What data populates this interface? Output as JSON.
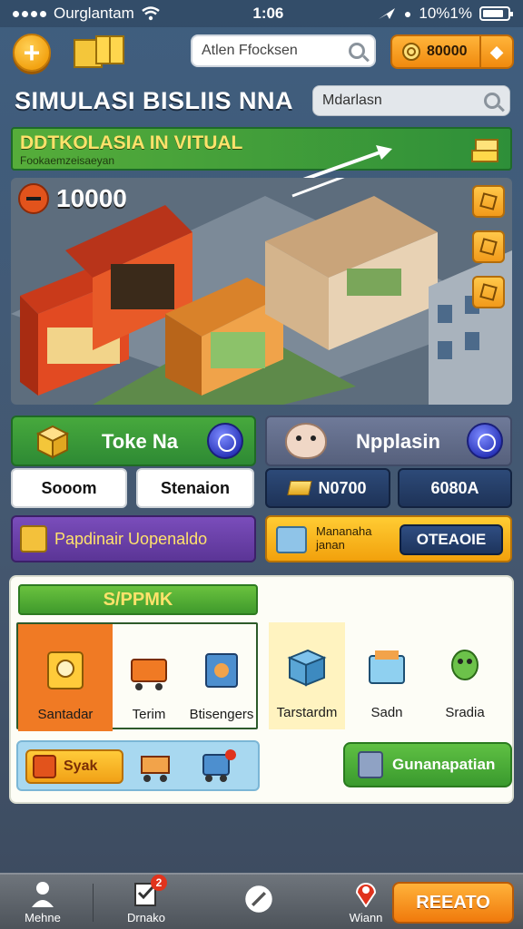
{
  "status_bar": {
    "carrier": "Ourglantam",
    "time": "1:06",
    "battery_percent": "10%1%"
  },
  "top_bar": {
    "search_placeholder": "Atlen Ffocksen",
    "coins": "80000"
  },
  "title_bar": {
    "title": "SIMULASI BISLIIS NNA",
    "search_text": "Mdarlasn"
  },
  "banner": {
    "headline": "DDTKOLASIA IN VITUAL",
    "subline": "Fookaemzeisaeyan"
  },
  "scene": {
    "score": "10000"
  },
  "cards": {
    "toko_label": "Toke Na",
    "toko_btn_1": "Sooom",
    "toko_btn_2": "Stenaion",
    "npplasin_label": "Npplasin",
    "npplasin_btn_1": "N0700",
    "npplasin_btn_2": "6080A",
    "purple_label": "Papdinair Uopenaldo",
    "orange_label": "Mananaha janan",
    "orange_pill": "OTEAOIE"
  },
  "shop": {
    "tab": "S/PPMK",
    "items": [
      {
        "label": "Santadar",
        "icon": "machine-icon"
      },
      {
        "label": "Terim",
        "icon": "cart-icon"
      },
      {
        "label": "Btisengers",
        "icon": "register-icon"
      },
      {
        "label": "Tarstardm",
        "icon": "box-icon"
      },
      {
        "label": "Sadn",
        "icon": "folder-icon"
      },
      {
        "label": "Sradia",
        "icon": "mascot-icon"
      }
    ],
    "syak_label": "Syak",
    "action_label": "Gunanapatian"
  },
  "bottom_nav": {
    "item_1": "Mehne",
    "item_2": "Drnako",
    "item_2_badge": "2",
    "item_4": "Wiann",
    "create": "REEATO"
  },
  "colors": {
    "accent_orange": "#f39a12",
    "accent_green": "#3f9a2c",
    "navy": "#1e3358"
  }
}
